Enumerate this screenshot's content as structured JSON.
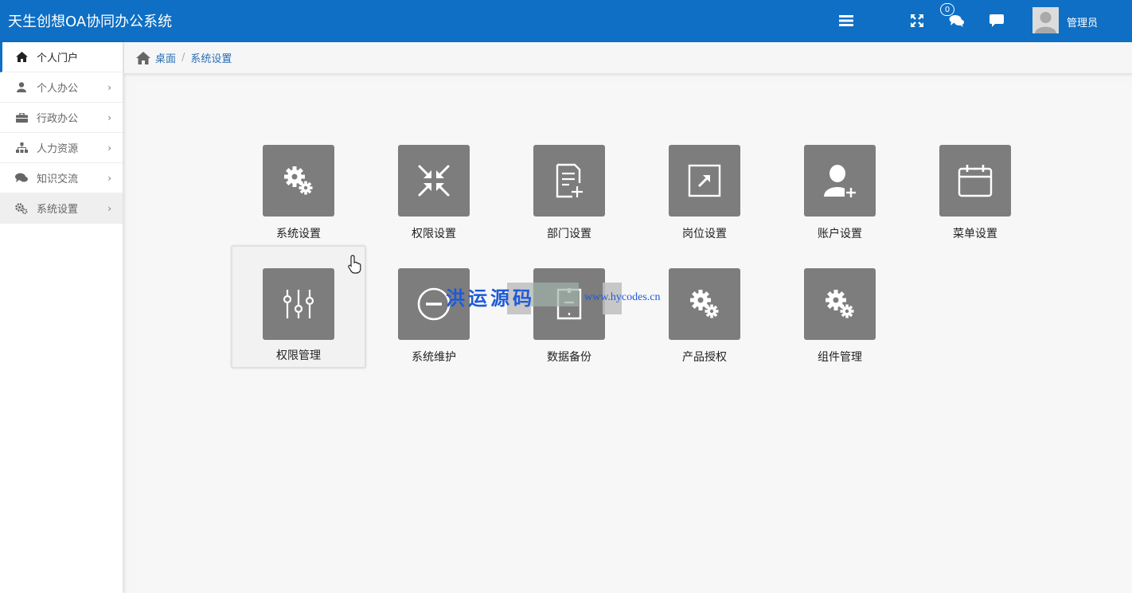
{
  "header": {
    "title": "天生创想OA协同办公系统",
    "message_count": "0",
    "username": "管理员",
    "icons": [
      "menu-icon",
      "fullscreen-icon",
      "chat-icon",
      "comment-icon"
    ],
    "color": "#0e6fc4"
  },
  "sidebar": {
    "items": [
      {
        "label": "个人门户",
        "icon": "home-icon"
      },
      {
        "label": "个人办公",
        "icon": "user-icon"
      },
      {
        "label": "行政办公",
        "icon": "briefcase-icon"
      },
      {
        "label": "人力资源",
        "icon": "org-chart-icon"
      },
      {
        "label": "知识交流",
        "icon": "comments-icon"
      },
      {
        "label": "系统设置",
        "icon": "gears-icon"
      }
    ],
    "chevron": "›"
  },
  "breadcrumb": {
    "home": "桌面",
    "separator": "/",
    "current": "系统设置"
  },
  "tiles": [
    {
      "label": "系统设置",
      "icon": "gears-icon"
    },
    {
      "label": "权限设置",
      "icon": "compress-icon"
    },
    {
      "label": "部门设置",
      "icon": "document-add-icon"
    },
    {
      "label": "岗位设置",
      "icon": "external-link-icon"
    },
    {
      "label": "账户设置",
      "icon": "user-add-icon"
    },
    {
      "label": "菜单设置",
      "icon": "calendar-icon"
    },
    {
      "label": "权限管理",
      "icon": "sliders-icon"
    },
    {
      "label": "系统维护",
      "icon": "minus-circle-icon"
    },
    {
      "label": "数据备份",
      "icon": "backup-icon"
    },
    {
      "label": "产品授权",
      "icon": "gears-icon"
    },
    {
      "label": "组件管理",
      "icon": "gears-icon"
    }
  ],
  "watermark": {
    "cn": "洪运源码",
    "url": "www.hycodes.cn"
  },
  "colors": {
    "tile_bg": "#7d7d7d",
    "link": "#2a6fb6",
    "watermark": "#1e5ad8"
  }
}
